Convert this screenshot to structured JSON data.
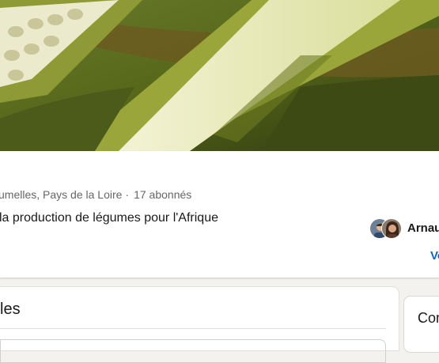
{
  "banner": {
    "image": "okra-pods-cover-photo"
  },
  "group": {
    "location": "umelles, Pays de la Loire",
    "separator": "·",
    "followers": "17 abonnés",
    "tagline": "la production de légumes pour l'Afrique"
  },
  "members": {
    "member_name": "Arnau",
    "see_link": "Vo"
  },
  "main": {
    "section_title": "les"
  },
  "side": {
    "title": "Con"
  },
  "colors": {
    "link": "#0a66c2",
    "text": "#191919",
    "muted": "#666666",
    "page_bg": "#f3f2ef"
  }
}
